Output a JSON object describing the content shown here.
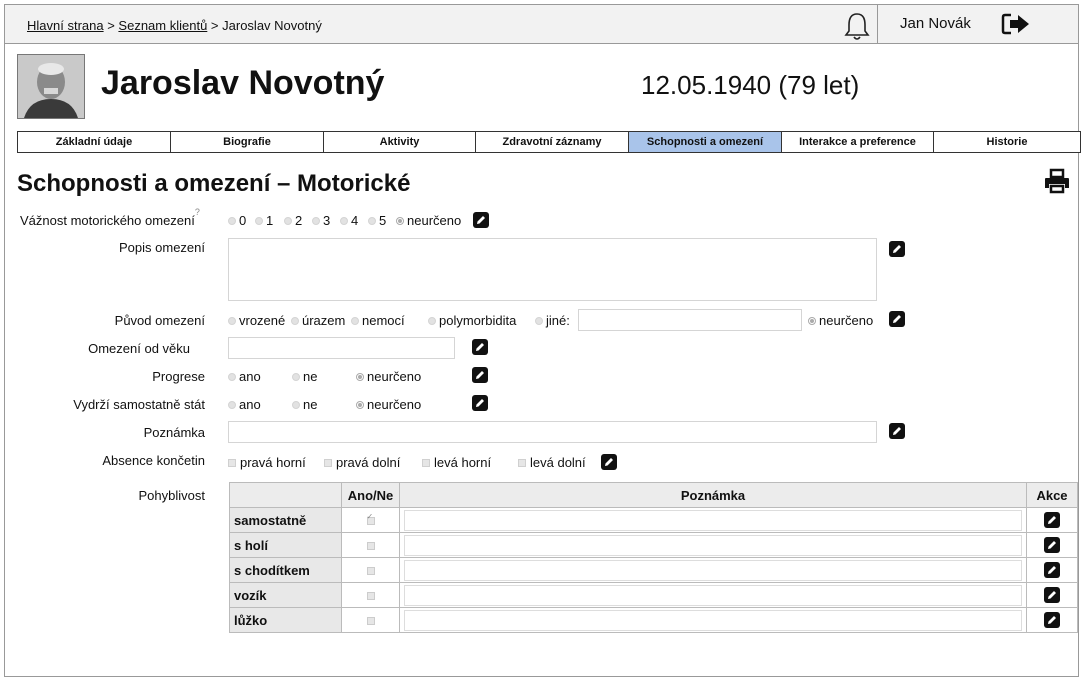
{
  "breadcrumb": {
    "home": "Hlavní strana",
    "sep1": " > ",
    "clients": "Seznam klientů",
    "sep2": " > ",
    "current": "Jaroslav Novotný"
  },
  "user": {
    "name": "Jan Novák"
  },
  "client": {
    "name": "Jaroslav Novotný",
    "dob": "12.05.1940 (79 let)"
  },
  "tabs": [
    {
      "label": "Základní údaje"
    },
    {
      "label": "Biografie"
    },
    {
      "label": "Aktivity"
    },
    {
      "label": "Zdravotní záznamy"
    },
    {
      "label": "Schopnosti a omezení",
      "active": true
    },
    {
      "label": "Interakce a preference"
    },
    {
      "label": "Historie"
    }
  ],
  "page_title": "Schopnosti a omezení – Motorické",
  "form": {
    "severity": {
      "label": "Vážnost motorického omezení",
      "help": "?",
      "options": [
        "0",
        "1",
        "2",
        "3",
        "4",
        "5",
        "neurčeno"
      ],
      "selected": "neurčeno"
    },
    "description": {
      "label": "Popis omezení",
      "value": ""
    },
    "origin": {
      "label": "Původ omezení",
      "options": [
        "vrozené",
        "úrazem",
        "nemocí",
        "polymorbidita",
        "jiné:"
      ],
      "other_value": "",
      "undetermined": "neurčeno"
    },
    "age_limit": {
      "label": "Omezení od věku",
      "value": ""
    },
    "progress": {
      "label": "Progrese",
      "options": [
        "ano",
        "ne",
        "neurčeno"
      ],
      "selected": "neurčeno"
    },
    "standing": {
      "label": "Vydrží samostatně stát",
      "options": [
        "ano",
        "ne",
        "neurčeno"
      ],
      "selected": "neurčeno"
    },
    "note": {
      "label": "Poznámka",
      "value": ""
    },
    "limbs": {
      "label": "Absence končetin",
      "options": [
        "pravá horní",
        "pravá dolní",
        "levá horní",
        "levá dolní"
      ]
    },
    "mobility": {
      "label": "Pohyblivost",
      "headers": {
        "blank": "",
        "yesno": "Ano/Ne",
        "note": "Poznámka",
        "action": "Akce"
      },
      "rows": [
        {
          "name": "samostatně",
          "checked": true,
          "note": ""
        },
        {
          "name": "s holí",
          "checked": false,
          "note": ""
        },
        {
          "name": "s chodítkem",
          "checked": false,
          "note": ""
        },
        {
          "name": "vozík",
          "checked": false,
          "note": ""
        },
        {
          "name": "lůžko",
          "checked": false,
          "note": ""
        }
      ]
    }
  }
}
